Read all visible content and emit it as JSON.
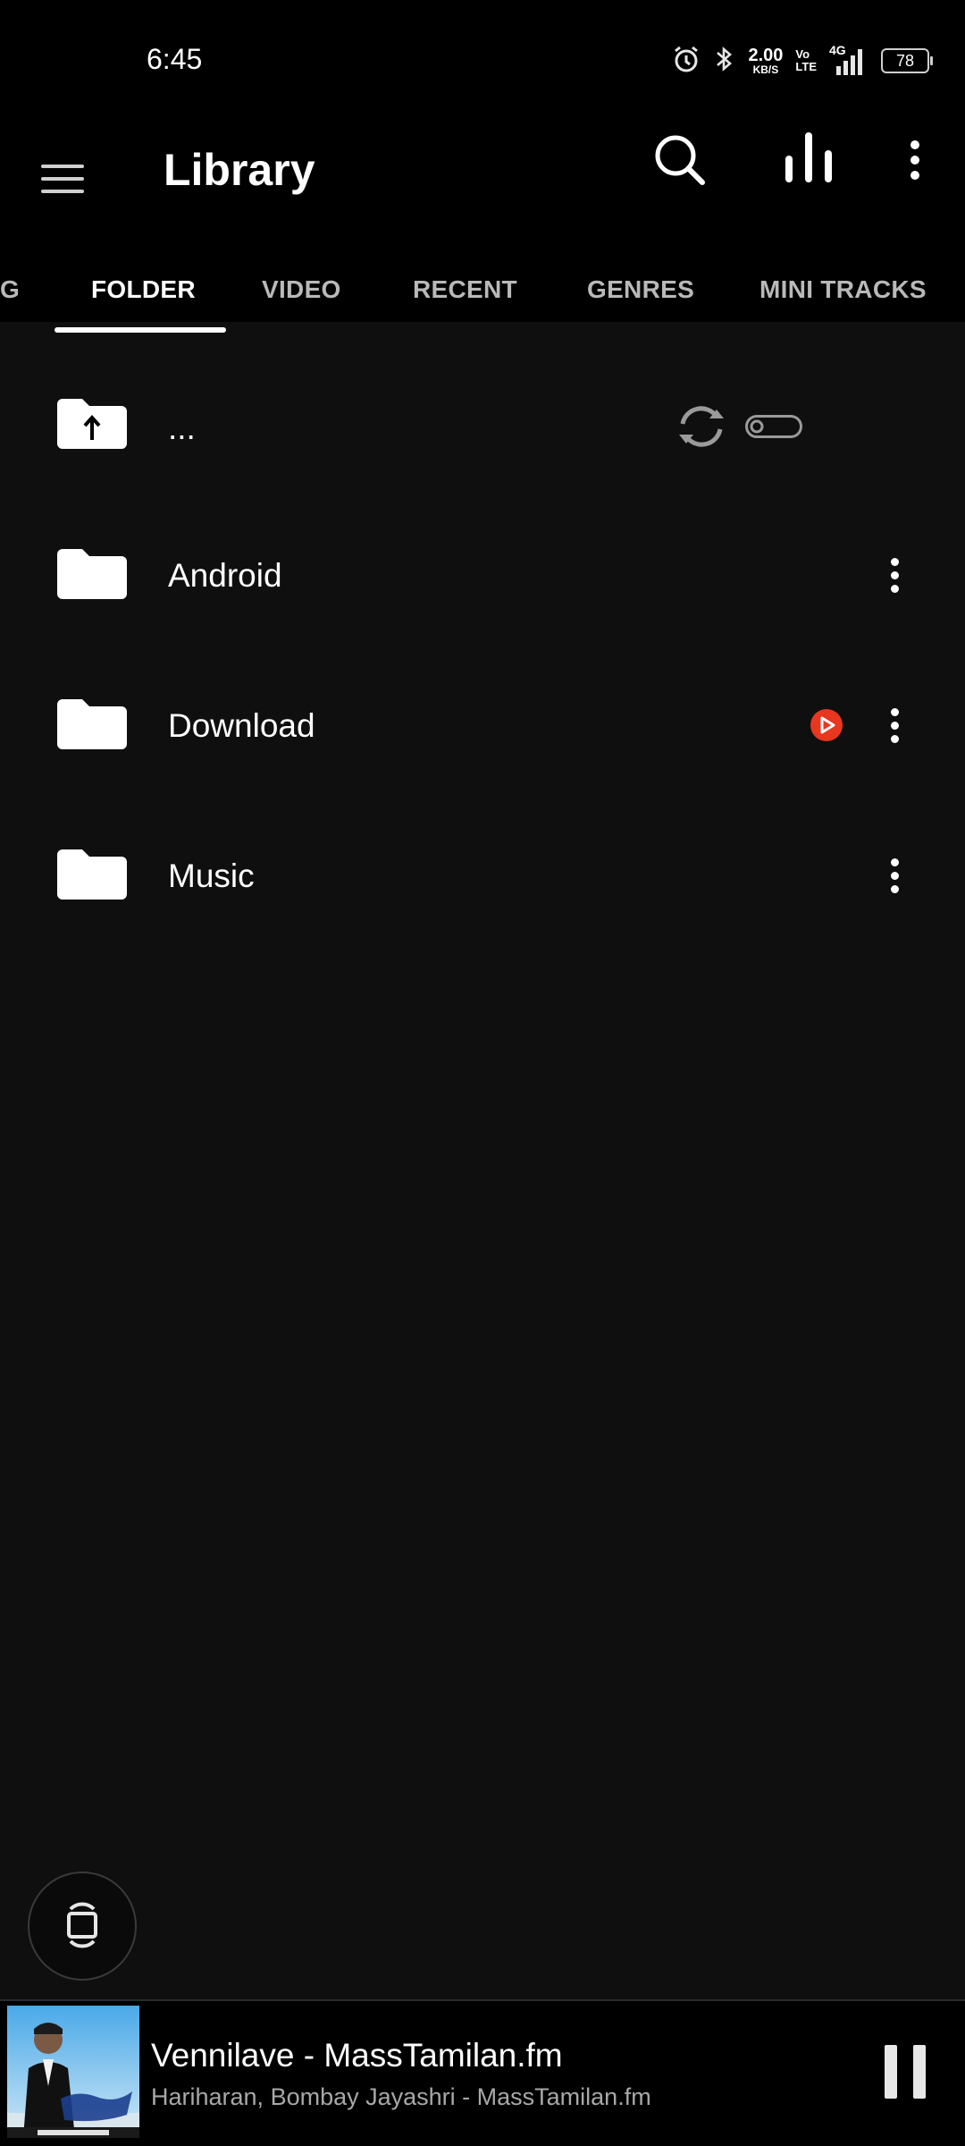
{
  "status_bar": {
    "time": "6:45",
    "net_speed_value": "2.00",
    "net_speed_unit": "KB/S",
    "volte_top": "Vo",
    "volte_bottom": "LTE",
    "network": "4G",
    "battery": "78",
    "icons": [
      "alarm-icon",
      "bluetooth-icon",
      "signal-icon",
      "battery-icon"
    ]
  },
  "app_bar": {
    "title": "Library",
    "icons": [
      "menu-icon",
      "search-icon",
      "equalizer-icon",
      "more-vert-icon"
    ]
  },
  "tabs": [
    {
      "label": "G",
      "active": false
    },
    {
      "label": "FOLDER",
      "active": true
    },
    {
      "label": "VIDEO",
      "active": false
    },
    {
      "label": "RECENT",
      "active": false
    },
    {
      "label": "GENRES",
      "active": false
    },
    {
      "label": "MINI TRACKS",
      "active": false
    }
  ],
  "folders": {
    "up": {
      "label": "...",
      "toggle_state": "off"
    },
    "items": [
      {
        "label": "Android",
        "has_play_badge": false
      },
      {
        "label": "Download",
        "has_play_badge": true
      },
      {
        "label": "Music",
        "has_play_badge": false
      }
    ]
  },
  "now_playing": {
    "title": "Vennilave - MassTamilan.fm",
    "artist": "Hariharan, Bombay Jayashri - MassTamilan.fm",
    "state": "playing"
  },
  "colors": {
    "background": "#0f0f0f",
    "bar": "#000000",
    "accent_badge": "#e8371f",
    "secondary_text": "#a8a8a8"
  }
}
